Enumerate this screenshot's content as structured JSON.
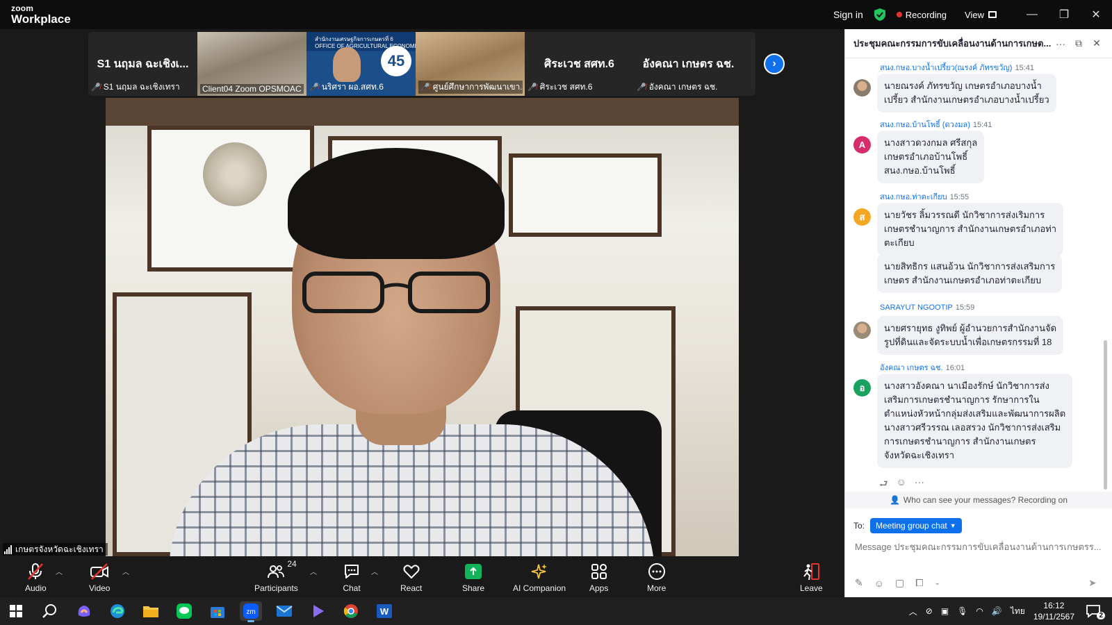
{
  "titlebar": {
    "logo_line1": "zoom",
    "logo_line2": "Workplace",
    "sign_in": "Sign in",
    "recording": "Recording",
    "view": "View"
  },
  "thumbnails": [
    {
      "big_text": "S1 นฤมล ฉะเชิงเ...",
      "caption": "S1 นฤมล ฉะเชิงเทรา",
      "muted": true
    },
    {
      "big_text": "",
      "caption": "Client04 Zoom OPSMOAC",
      "muted": false
    },
    {
      "big_text": "",
      "caption": "นริศรา ผอ.สศท.6",
      "muted": true,
      "banner": "สำนักงานเศรษฐกิจการเกษตรที่ 6\nOFFICE OF AGRICULTURAL ECONOMICS",
      "badge": "45"
    },
    {
      "big_text": "",
      "caption": "ศูนย์ศึกษาการพัฒนาเขา...",
      "muted": true
    },
    {
      "big_text": "ศิระเวช สศท.6",
      "caption": "ศิระเวช สศท.6",
      "muted": true
    },
    {
      "big_text": "อังคณา เกษตร ฉช.",
      "caption": "อังคณา เกษตร ฉช.",
      "muted": true
    }
  ],
  "main_video": {
    "name_label": "เกษตรจังหวัดฉะเชิงเทรา"
  },
  "toolbar": {
    "audio": "Audio",
    "video": "Video",
    "participants": "Participants",
    "participants_count": "24",
    "chat": "Chat",
    "react": "React",
    "share": "Share",
    "ai_companion": "AI Companion",
    "apps": "Apps",
    "more": "More",
    "leave": "Leave"
  },
  "chat": {
    "title": "ประชุมคณะกรรมการขับเคลื่อนงานด้านการเกษต...",
    "messages": [
      {
        "sender": "สนง.กษอ.บางน้ำเปรี้ยว(ณรงค์ ภัทรขวัญ)",
        "time": "15:41",
        "avatar": "photo",
        "avatar_color": "#8a7c6c",
        "lines": [
          "นายณรงค์ ภัทรขวัญ เกษตรอำเภอบางน้ำ",
          "เปรี้ยว สำนักงานเกษตรอำเภอบางน้ำเปรี้ยว"
        ]
      },
      {
        "sender": "สนง.กษอ.บ้านโพธิ์ (ดวงมล)",
        "time": "15:41",
        "avatar": "A",
        "avatar_color": "#d62c6b",
        "lines": [
          "นางสาวดวงกมล ศรีสกุล",
          "เกษตรอำเภอบ้านโพธิ์",
          "สนง.กษอ.บ้านโพธิ์"
        ]
      },
      {
        "sender": "สนง.กษอ.ท่าตะเกียบ",
        "time": "15:55",
        "avatar": "ส",
        "avatar_color": "#f5a623",
        "lines": [
          "นายวัชร ลิ้มวรรณดี นักวิชาการส่งเริมการ",
          "เกษตรชำนาญการ สำนักงานเกษตรอำเภอท่า",
          "ตะเกียบ"
        ]
      },
      {
        "sender": "",
        "time": "",
        "avatar": "",
        "avatar_color": "",
        "lines": [
          "นายสิทธิกร แสนอ้วน นักวิชาการส่งเสริมการ",
          "เกษตร สำนักงานเกษตรอำเภอท่าตะเกียบ"
        ]
      },
      {
        "sender": "SARAYUT NGOOTIP",
        "time": "15:59",
        "avatar": "photo",
        "avatar_color": "#9a8a78",
        "lines": [
          "นายศรายุทธ งูทิพย์ ผู้อำนวยการสำนักงานจัด",
          "รูปที่ดินและจัดระบบน้ำเพื่อเกษตรกรรมที่ 18"
        ]
      },
      {
        "sender": "อังคณา เกษตร ฉช.",
        "time": "16:01",
        "avatar": "อ",
        "avatar_color": "#1aa260",
        "lines": [
          "นางสาวอังคณา  นาเมืองรักษ์  นักวิชาการส่ง",
          "เสริมการเกษตรชำนาญการ  รักษาการใน",
          "ตำแหน่งหัวหน้ากลุ่มส่งเสริมและพัฒนาการผลิต",
          "นางสาวศรีวรรณ เลอสรวง  นักวิชาการส่งเสริม",
          "การเกษตรชำนาญการ  สำนักงานเกษตร",
          "จังหวัดฉะเชิงเทรา"
        ]
      }
    ],
    "privacy_note": "Who can see your messages? Recording on",
    "to_label": "To:",
    "to_value": "Meeting group chat",
    "input_placeholder": "Message ประชุมคณะกรรมการขับเคลื่อนงานด้านการเกษตรร..."
  },
  "taskbar": {
    "time": "16:12",
    "date": "19/11/2567",
    "language": "ไทย",
    "notifications": "2"
  },
  "colors": {
    "accent": "#0e71eb",
    "recording": "#e5322e",
    "share": "#12b35a",
    "leave": "#e5322e"
  }
}
